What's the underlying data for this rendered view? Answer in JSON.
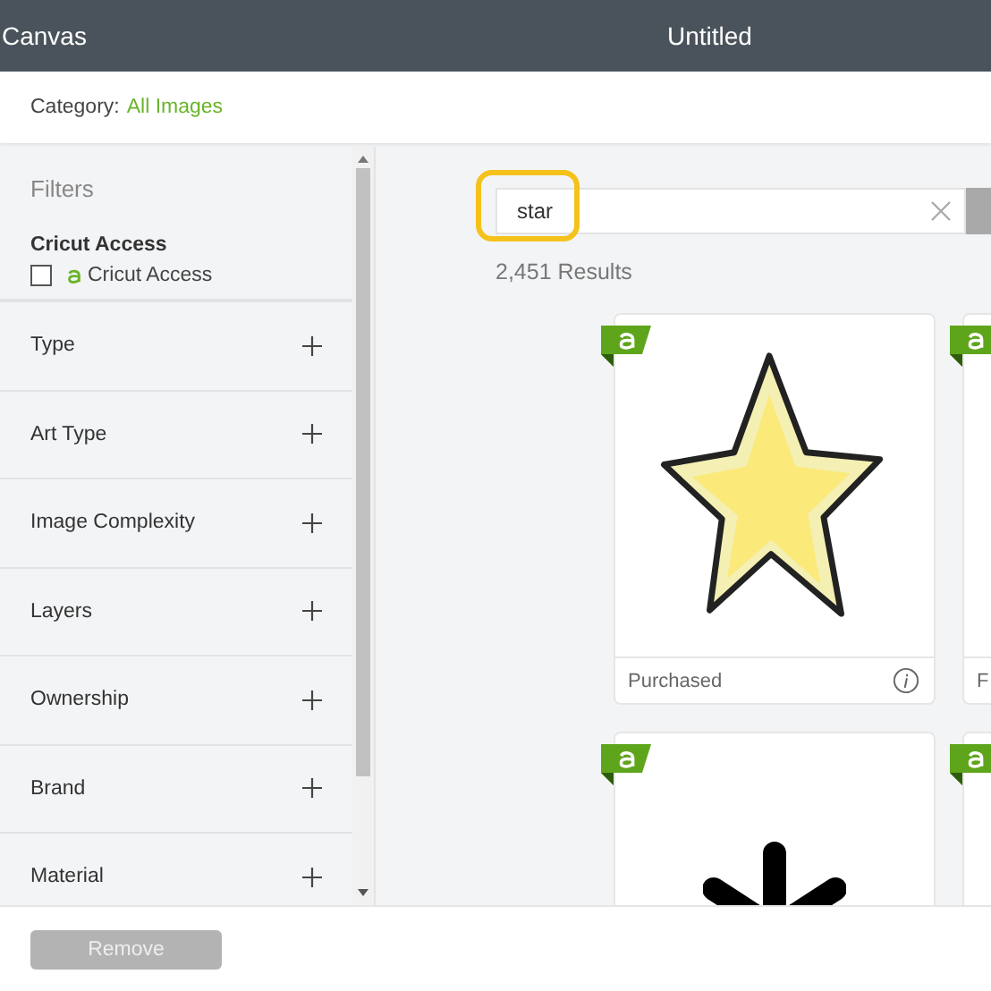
{
  "header": {
    "app": "Canvas",
    "title": "Untitled"
  },
  "category": {
    "label": "Category:",
    "value": "All Images"
  },
  "filters": {
    "title": "Filters",
    "access_heading": "Cricut Access",
    "access_option": {
      "label": "Cricut Access",
      "checked": false
    },
    "groups": [
      {
        "label": "Type",
        "expanded": false
      },
      {
        "label": "Art Type",
        "expanded": false
      },
      {
        "label": "Image Complexity",
        "expanded": false
      },
      {
        "label": "Layers",
        "expanded": false
      },
      {
        "label": "Ownership",
        "expanded": false
      },
      {
        "label": "Brand",
        "expanded": false
      },
      {
        "label": "Material",
        "expanded": false
      }
    ]
  },
  "search": {
    "value": "star",
    "highlighted": true
  },
  "results": "2,451 Results",
  "cards": [
    {
      "kind": "star",
      "status": "Purchased",
      "access": true
    },
    {
      "kind": "blank",
      "status": "F",
      "access": true
    },
    {
      "kind": "asterisk",
      "access": true
    },
    {
      "kind": "blank",
      "access": true
    }
  ],
  "footer": {
    "button": "Remove",
    "disabled": true
  }
}
